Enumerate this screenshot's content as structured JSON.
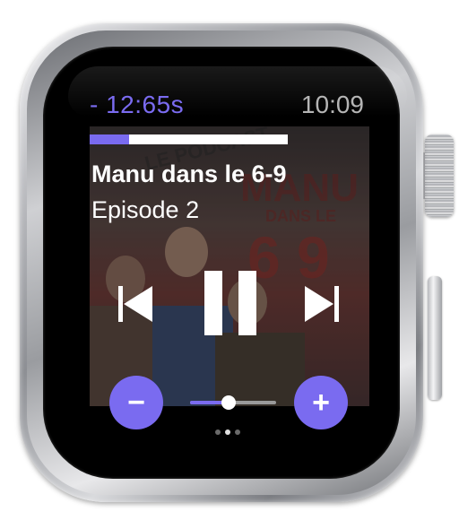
{
  "status": {
    "remaining_time": "- 12:65s",
    "clock": "10:09"
  },
  "episode": {
    "title": "Manu dans le 6-9",
    "subtitle": "Episode 2",
    "progress_fraction": 0.2
  },
  "artwork": {
    "lines": [
      "MANU",
      "DANS LE",
      "6 9",
      "LE PODCAST"
    ]
  },
  "volume": {
    "level_fraction": 0.45,
    "minus_label": "−",
    "plus_label": "+"
  },
  "pagination": {
    "total": 3,
    "active": 1
  },
  "colors": {
    "accent": "#7a6bf0",
    "status_clock": "#b5b5b5",
    "screen_bg": "#000000"
  },
  "icons": {
    "previous": "skip-previous-icon",
    "pause": "pause-icon",
    "next": "skip-next-icon",
    "minus": "minus-icon",
    "plus": "plus-icon"
  }
}
